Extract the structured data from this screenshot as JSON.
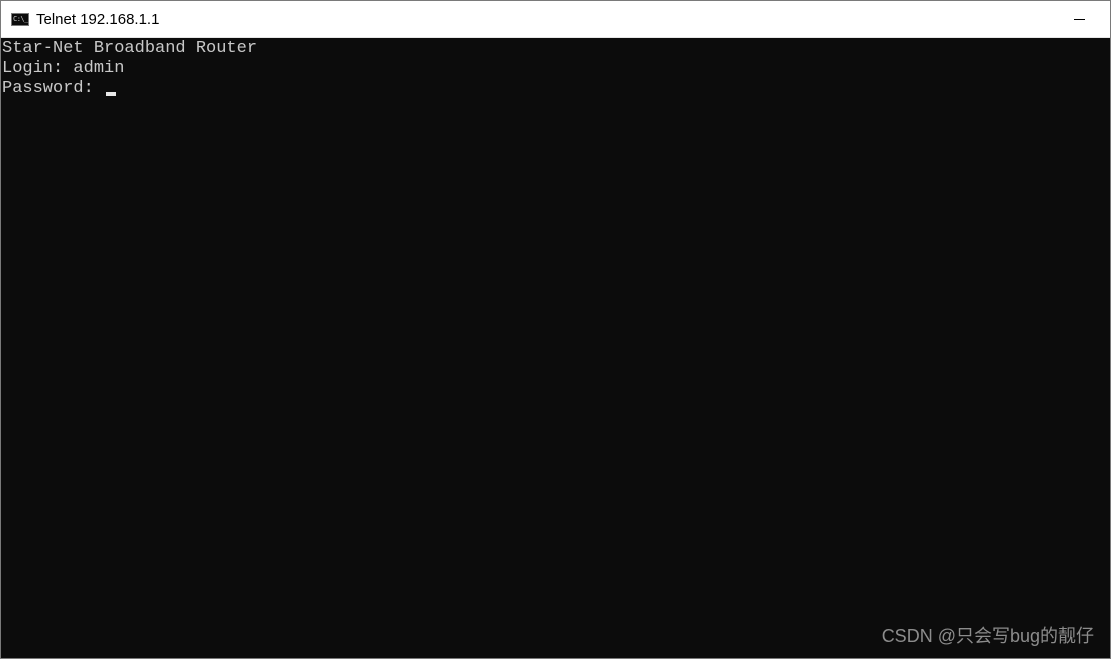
{
  "window": {
    "title": "Telnet 192.168.1.1",
    "icon": "console-icon"
  },
  "console": {
    "banner": "Star-Net Broadband Router",
    "login_prompt": "Login: ",
    "login_value": "admin",
    "password_prompt": "Password: "
  },
  "watermark": "CSDN @只会写bug的靓仔",
  "colors": {
    "console_bg": "#0c0c0c",
    "console_text": "#c8c8c8",
    "titlebar_bg": "#ffffff"
  }
}
